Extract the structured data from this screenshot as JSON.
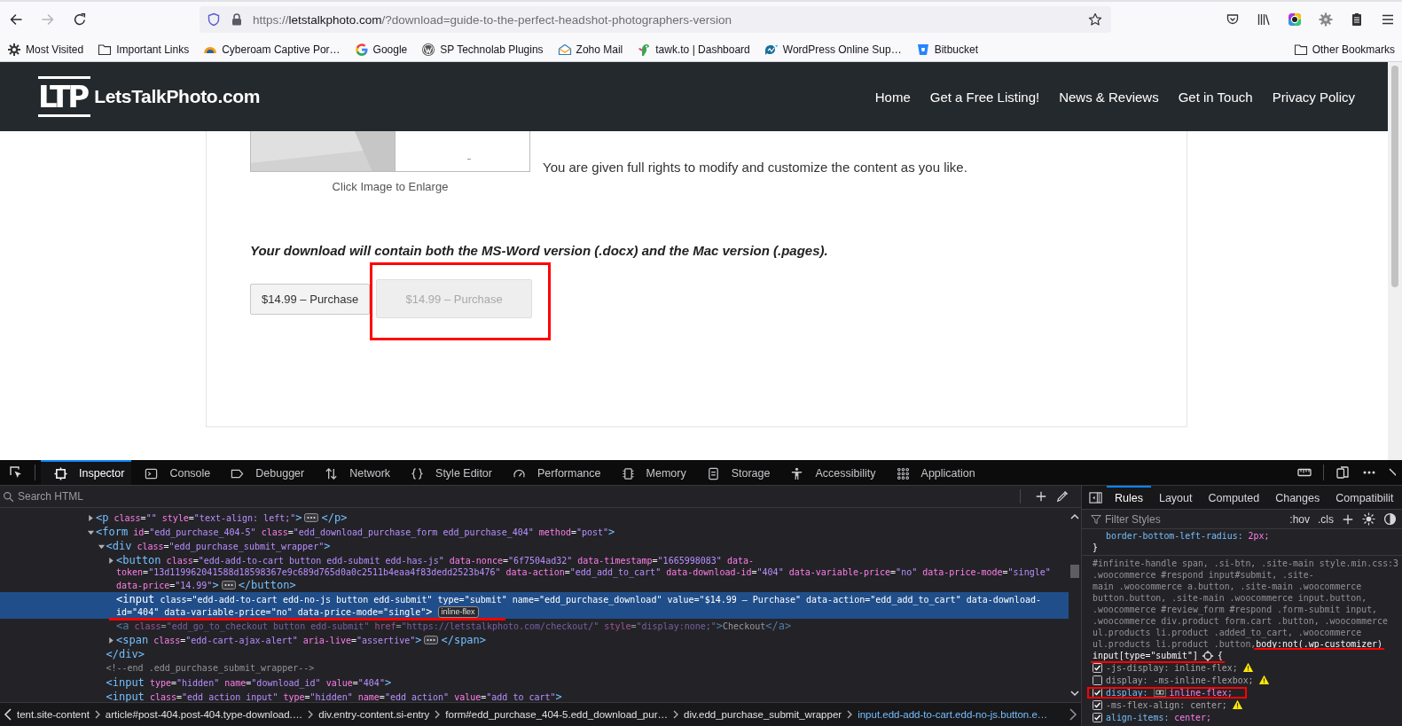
{
  "browser": {
    "nav": [
      {
        "kind": "back",
        "disabled": false
      },
      {
        "kind": "forward",
        "disabled": true
      },
      {
        "kind": "reload",
        "disabled": false
      }
    ],
    "url": "https://letstalkphoto.com/?download=guide-to-the-perfect-headshot-photographers-version",
    "bookmarks": [
      {
        "label": "Most Visited",
        "kind": "gear"
      },
      {
        "label": "Important Links",
        "kind": "folder"
      },
      {
        "label": "Cyberoam Captive Por…",
        "kind": "arc"
      },
      {
        "label": "Google",
        "kind": "google"
      },
      {
        "label": "SP Technolab Plugins",
        "kind": "wordpress"
      },
      {
        "label": "Zoho Mail",
        "kind": "mail"
      },
      {
        "label": "tawk.to | Dashboard",
        "kind": "bird"
      },
      {
        "label": "WordPress Online Sup…",
        "kind": "bubble"
      },
      {
        "label": "Bitbucket",
        "kind": "bucket"
      }
    ],
    "other_bookmarks": {
      "label": "Other Bookmarks",
      "kind": "folder"
    }
  },
  "site": {
    "logo": {
      "mark": "LTP",
      "name": "LetsTalkPhoto.com"
    },
    "nav": [
      "Home",
      "Get a Free Listing!",
      "News & Reviews",
      "Get in Touch",
      "Privacy Policy"
    ],
    "image": {
      "kind": "picture",
      "caption": "Click Image to Enlarge"
    },
    "paragraph": "You are given full rights to modify and customize the content as you like.",
    "notice": "Your download will contain both the MS-Word version (.docx) and the Mac version (.pages).",
    "buttons": [
      {
        "label": "$14.99 – Purchase",
        "disabled": false
      },
      {
        "label": "$14.99 – Purchase",
        "disabled": true,
        "annotated": true
      }
    ]
  },
  "devtools": {
    "tabs": [
      {
        "label": "Inspector",
        "kind": "inspector",
        "selected": true
      },
      {
        "label": "Console",
        "kind": "console",
        "selected": false
      },
      {
        "label": "Debugger",
        "kind": "debugger",
        "selected": false
      },
      {
        "label": "Network",
        "kind": "network",
        "selected": false
      },
      {
        "label": "Style Editor",
        "kind": "style",
        "selected": false
      },
      {
        "label": "Performance",
        "kind": "performance",
        "selected": false
      },
      {
        "label": "Memory",
        "kind": "memory",
        "selected": false
      },
      {
        "label": "Storage",
        "kind": "storage",
        "selected": false
      },
      {
        "label": "Accessibility",
        "kind": "accessibility",
        "selected": false
      },
      {
        "label": "Application",
        "kind": "application",
        "selected": false
      }
    ],
    "search": {
      "placeholder": "Search HTML"
    },
    "tree": [
      {
        "open": [
          "<p class=\"\" style=\"text-align: left;\">"
        ],
        "close": "</p>",
        "expanded": false,
        "selected": false
      },
      {
        "open": [
          "<form id=\"edd_purchase_404-5\" class=\"edd_download_purchase_form edd_purchase_404\" method=\"post\">"
        ],
        "expanded": true,
        "selected": false,
        "children": [
          {
            "open": [
              "<div class=\"edd_purchase_submit_wrapper\">"
            ],
            "close": "</div>",
            "expanded": true,
            "selected": false,
            "children": [
              {
                "open": [
                  "<button class=\"edd-add-to-cart button edd-submit edd-has-js\" data-nonce=\"6f7504ad32\" data-timestamp=\"1665998083\" data-",
                  "token=\"13d119962041588d18598367e9c689d765d0a0c2511b4eaa4f83dedd2523b476\" data-action=\"edd_add_to_cart\" data-download-id=\"404\" data-variable-price=\"no\" data-price-mode=\"single\"",
                  "data-price=\"14.99\">"
                ],
                "close": "</button>",
                "expanded": false,
                "selected": false
              },
              {
                "open": [
                  "<input class=\"edd-add-to-cart edd-no-js button edd-submit\" type=\"submit\" name=\"edd_purchase_download\" value=\"$14.99 – Purchase\" data-action=\"edd_add_to_cart\" data-download-",
                  "id=\"404\" data-variable-price=\"no\" data-price-mode=\"single\">"
                ],
                "badge": "inline-flex",
                "selected": true,
                "annotated": true
              },
              {
                "open": [
                  "<a class=\"edd_go_to_checkout button edd-submit\" href=\"https://letstalkphoto.com/checkout/\" style=\"display:none;\">Checkout</a>"
                ],
                "hidden": true,
                "selected": false
              },
              {
                "open": [
                  "<span class=\"edd-cart-ajax-alert\" aria-live=\"assertive\">"
                ],
                "close": "</span>",
                "expanded": false,
                "selected": false
              }
            ]
          },
          {
            "open": [
              "<!--end .edd_purchase_submit_wrapper-->"
            ],
            "selected": false
          },
          {
            "open": [
              "<input type=\"hidden\" name=\"download_id\" value=\"404\">"
            ],
            "selected": false
          },
          {
            "open": [
              "<input class=\"edd_action_input\" type=\"hidden\" name=\"edd_action\" value=\"add_to_cart\">"
            ],
            "selected": false
          }
        ]
      }
    ],
    "breadcrumbs": [
      {
        "label": "tent.site-content",
        "selected": false
      },
      {
        "label": "article#post-404.post-404.type-download.…",
        "selected": false
      },
      {
        "label": "div.entry-content.si-entry",
        "selected": false
      },
      {
        "label": "form#edd_purchase_404-5.edd_download_pur…",
        "selected": false
      },
      {
        "label": "div.edd_purchase_submit_wrapper",
        "selected": false
      },
      {
        "label": "input.edd-add-to-cart.edd-no-js.button.e…",
        "selected": true
      }
    ],
    "sidebar_tabs": [
      {
        "label": "Rules",
        "selected": true
      },
      {
        "label": "Layout",
        "selected": false
      },
      {
        "label": "Computed",
        "selected": false
      },
      {
        "label": "Changes",
        "selected": false
      },
      {
        "label": "Compatibilit",
        "selected": false
      }
    ],
    "filter": {
      "placeholder": "Filter Styles"
    },
    "filter_toggles": [
      ":hov",
      ".cls"
    ],
    "rules": [
      {
        "declarations": [
          {
            "kind": "plain",
            "name": "border-bottom-left-radius:",
            "value": "2px;",
            "overridden": false,
            "warning": false
          }
        ],
        "close": "}"
      },
      {
        "selector_lines": [
          {
            "segments": [
              {
                "text": "#infinite-handle span, .si-btn, .site-main",
                "matched": false
              }
            ],
            "source": "style.min.css:3"
          },
          {
            "segments": [
              {
                "text": ".woocommerce #respond input#submit, .site-",
                "matched": false
              }
            ]
          },
          {
            "segments": [
              {
                "text": "main .woocommerce a.button, .site-main .woocommerce",
                "matched": false
              }
            ]
          },
          {
            "segments": [
              {
                "text": "button.button, .site-main .woocommerce input.button,",
                "matched": false
              }
            ]
          },
          {
            "segments": [
              {
                "text": ".woocommerce #review_form #respond .form-submit input,",
                "matched": false
              }
            ]
          },
          {
            "segments": [
              {
                "text": ".woocommerce div.product form.cart .button, .woocommerce",
                "matched": false
              }
            ]
          },
          {
            "segments": [
              {
                "text": "ul.products li.product .added_to_cart, .woocommerce",
                "matched": false
              }
            ]
          },
          {
            "segments": [
              {
                "text": "ul.products li.product .button,",
                "matched": false
              },
              {
                "text": "body:not(.wp-customizer)",
                "matched": true,
                "annotated": true
              }
            ]
          },
          {
            "segments": [
              {
                "text": "input[type=\"submit\"]",
                "matched": true
              }
            ],
            "open": "{",
            "annotated": true
          }
        ],
        "declarations": [
          {
            "kind": "plain",
            "checked": true,
            "name": "-js-display:",
            "value": "inline-flex;",
            "overridden": true,
            "warning": true
          },
          {
            "kind": "plain",
            "checked": false,
            "name": "display:",
            "value": "-ms-inline-flexbox;",
            "overridden": true,
            "warning": true
          },
          {
            "kind": "layout",
            "checked": true,
            "name": "display:",
            "value": "inline-flex;",
            "overridden": false,
            "warning": false,
            "annotated": true
          },
          {
            "kind": "plain",
            "checked": true,
            "name": "-ms-flex-align:",
            "value": "center;",
            "overridden": true,
            "warning": true
          },
          {
            "kind": "plain",
            "checked": true,
            "name": "align-items:",
            "value": "center;",
            "overridden": false,
            "warning": false
          }
        ]
      }
    ]
  }
}
